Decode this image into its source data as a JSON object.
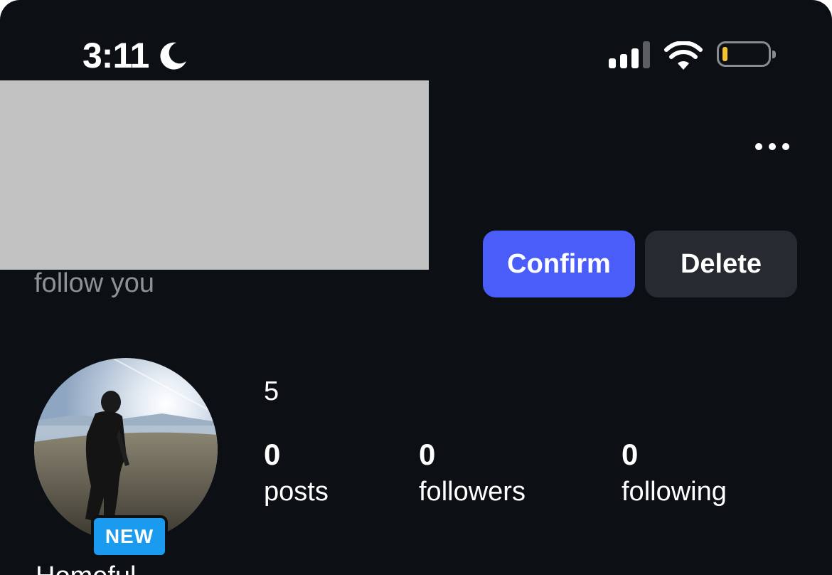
{
  "status_bar": {
    "time": "3:11",
    "icons": [
      "moon-icon",
      "cellular-signal-icon",
      "wifi-icon",
      "battery-icon"
    ],
    "battery_color": "#f4c430"
  },
  "header": {
    "request_text": "follow you",
    "confirm_label": "Confirm",
    "delete_label": "Delete",
    "more_icon": "more-options-icon"
  },
  "profile": {
    "badge": "NEW",
    "top_value": "5",
    "stats": [
      {
        "value": "0",
        "label": "posts"
      },
      {
        "value": "0",
        "label": "followers"
      },
      {
        "value": "0",
        "label": "following"
      }
    ],
    "bio_peek": "Homeful"
  },
  "colors": {
    "background": "#0c1014",
    "confirm": "#4a5df9",
    "delete": "#272b31",
    "badge": "#1a9bf0",
    "redaction": "#c2c2c2"
  }
}
